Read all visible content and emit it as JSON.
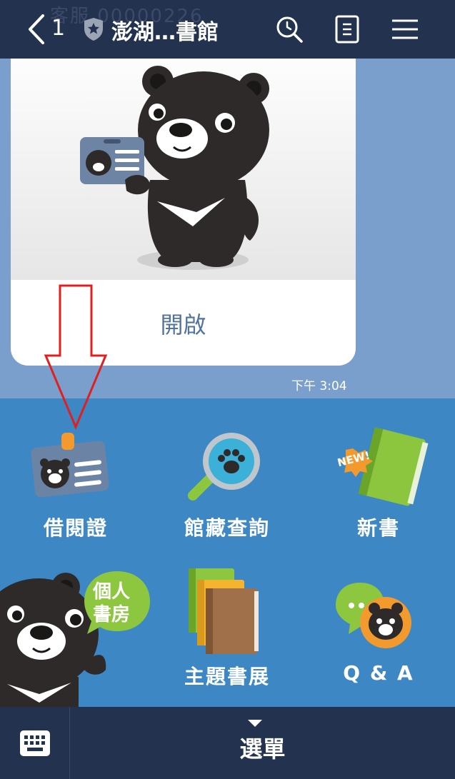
{
  "header": {
    "back_count": "1",
    "title": "澎湖…書館",
    "ghost_text": "客服    00000226",
    "icons": [
      "back-chevron-icon",
      "shield-star-icon",
      "search-icon",
      "notes-icon",
      "menu-icon"
    ]
  },
  "chat": {
    "card_button": "開啟",
    "timestamp": "下午 3:04"
  },
  "rich_menu": {
    "items": [
      {
        "label": "借閱證",
        "icon": "library-card-icon"
      },
      {
        "label": "館藏查詢",
        "icon": "magnifier-paw-icon"
      },
      {
        "label": "新書",
        "icon": "new-book-icon"
      },
      {
        "label": "",
        "icon": "bear-mascot-icon",
        "badge": "個人\n書房"
      },
      {
        "label": "主題書展",
        "icon": "book-stack-icon"
      },
      {
        "label": "Q & A",
        "icon": "chat-bear-icon"
      }
    ],
    "badge_line1": "個人",
    "badge_line2": "書房",
    "new_badge": "NEW!"
  },
  "bottom_bar": {
    "menu_label": "選單"
  },
  "colors": {
    "header": "#23324f",
    "chat_bg": "#7b9fcd",
    "menu_bg": "#3c87c4",
    "annotation_arrow": "#e02020"
  }
}
